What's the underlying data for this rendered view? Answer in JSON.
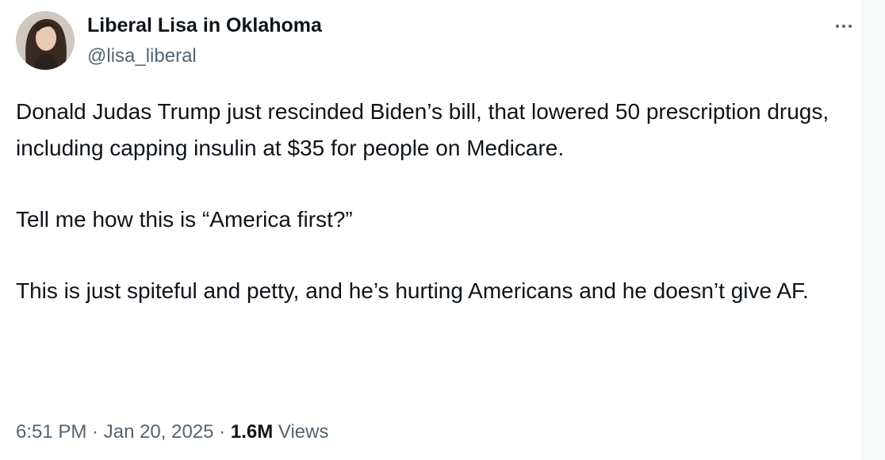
{
  "author": {
    "display_name": "Liberal Lisa in Oklahoma",
    "handle": "@lisa_liberal"
  },
  "more_icon": "ellipsis-icon",
  "tweet": {
    "paragraphs": [
      "Donald Judas Trump just rescinded Biden’s bill, that lowered 50 prescription drugs, including capping insulin at $35 for people on Medicare.",
      "Tell me how this is “America first?”",
      "This is just spiteful and petty, and he’s hurting Americans and he doesn’t give AF."
    ]
  },
  "meta": {
    "time": "6:51 PM",
    "sep1": " · ",
    "date": "Jan 20, 2025",
    "sep2": " · ",
    "views_count": "1.6M",
    "views_label": " Views"
  },
  "colors": {
    "text": "#0f1419",
    "secondary": "#536471",
    "background": "#ffffff"
  }
}
